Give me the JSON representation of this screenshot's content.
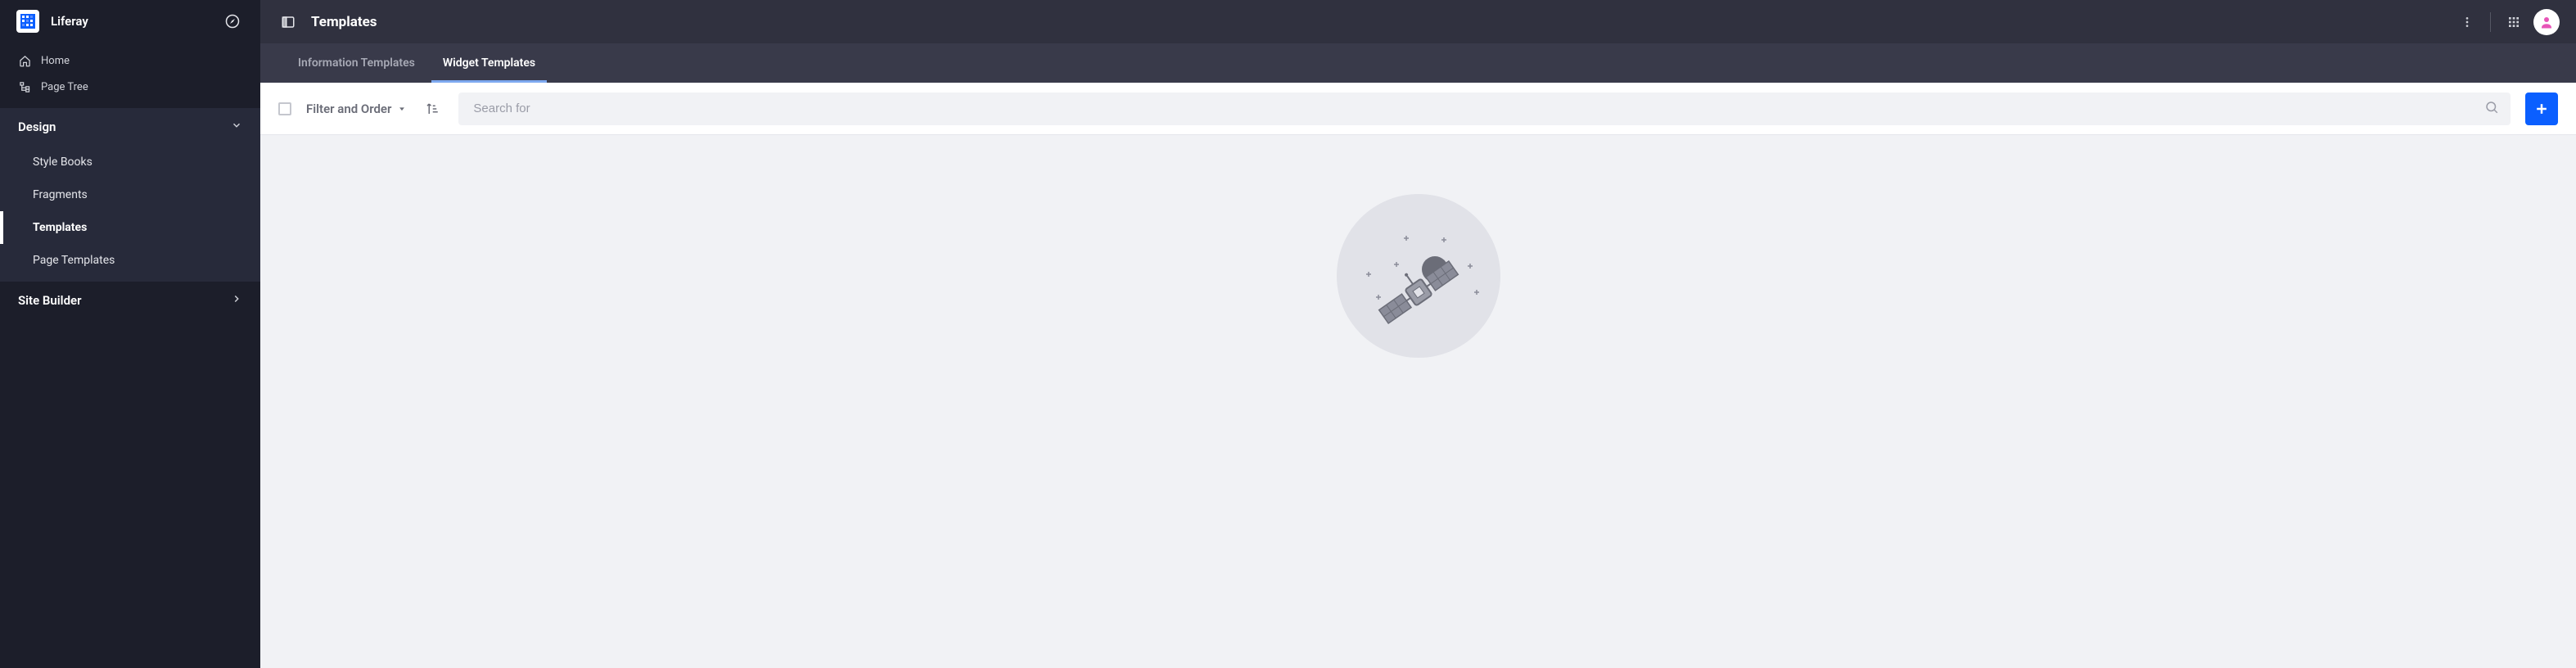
{
  "brand": {
    "name": "Liferay"
  },
  "sidebar": {
    "links": [
      {
        "label": "Home"
      },
      {
        "label": "Page Tree"
      }
    ],
    "sections": [
      {
        "label": "Design",
        "expanded": true,
        "items": [
          {
            "label": "Style Books",
            "active": false
          },
          {
            "label": "Fragments",
            "active": false
          },
          {
            "label": "Templates",
            "active": true
          },
          {
            "label": "Page Templates",
            "active": false
          }
        ]
      },
      {
        "label": "Site Builder",
        "expanded": false,
        "items": []
      }
    ]
  },
  "header": {
    "title": "Templates"
  },
  "tabs": [
    {
      "label": "Information Templates",
      "active": false
    },
    {
      "label": "Widget Templates",
      "active": true
    }
  ],
  "toolbar": {
    "filter_label": "Filter and Order",
    "search_placeholder": "Search for"
  }
}
